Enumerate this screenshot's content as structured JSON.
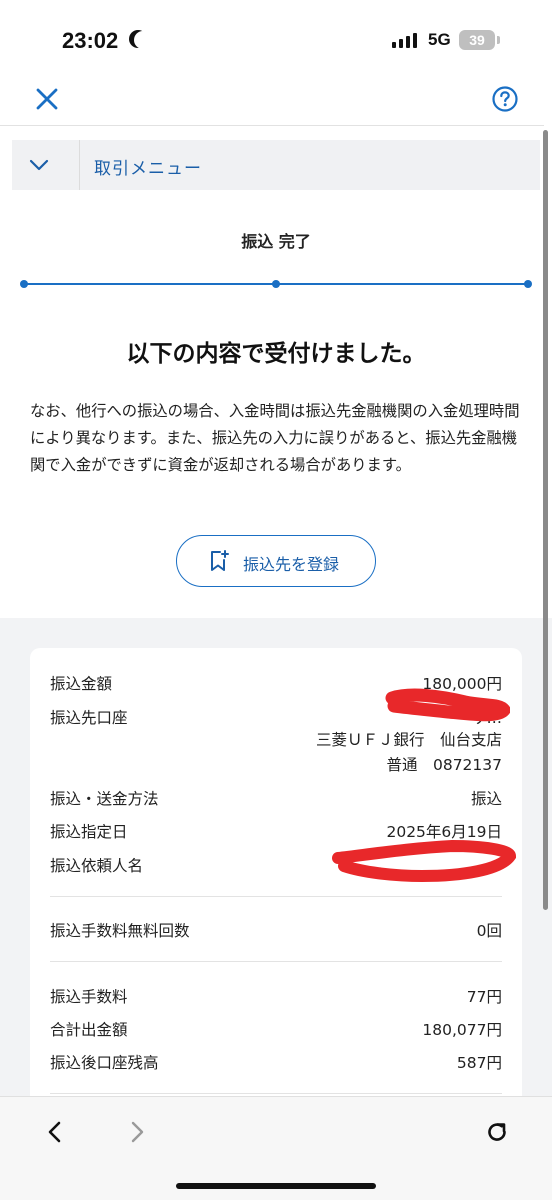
{
  "status_bar": {
    "time": "23:02",
    "network": "5G",
    "battery": "39"
  },
  "nav": {
    "close_icon": "close-icon",
    "help_icon": "help-icon"
  },
  "menu": {
    "label": "取引メニュー"
  },
  "page": {
    "title": "振込 完了",
    "headline": "以下の内容で受付けました。",
    "notice": "なお、他行への振込の場合、入金時間は振込先金融機関の入金処理時間により異なります。また、振込先の入力に誤りがあると、振込先金融機関で入金ができずに資金が返却される場合があります。",
    "register_button": "振込先を登録"
  },
  "progress": {
    "steps_total": 3,
    "current_step": 3
  },
  "details": {
    "amount_label": "振込金額",
    "amount": "180,000円",
    "dest_label": "振込先口座",
    "dest_name": "サ…",
    "dest_bank": "三菱ＵＦＪ銀行　仙台支店",
    "dest_account": "普通　0872137",
    "method_label": "振込・送金方法",
    "method": "振込",
    "date_label": "振込指定日",
    "date": "2025年6月19日",
    "requester_label": "振込依頼人名",
    "requester": "…",
    "free_count_label": "振込手数料無料回数",
    "free_count": "0回",
    "fee_label": "振込手数料",
    "fee": "77円",
    "total_label": "合計出金額",
    "total": "180,077円",
    "balance_label": "振込後口座残高",
    "balance": "587円"
  },
  "colors": {
    "accent": "#1a6fc4",
    "redaction": "#e8282a"
  }
}
